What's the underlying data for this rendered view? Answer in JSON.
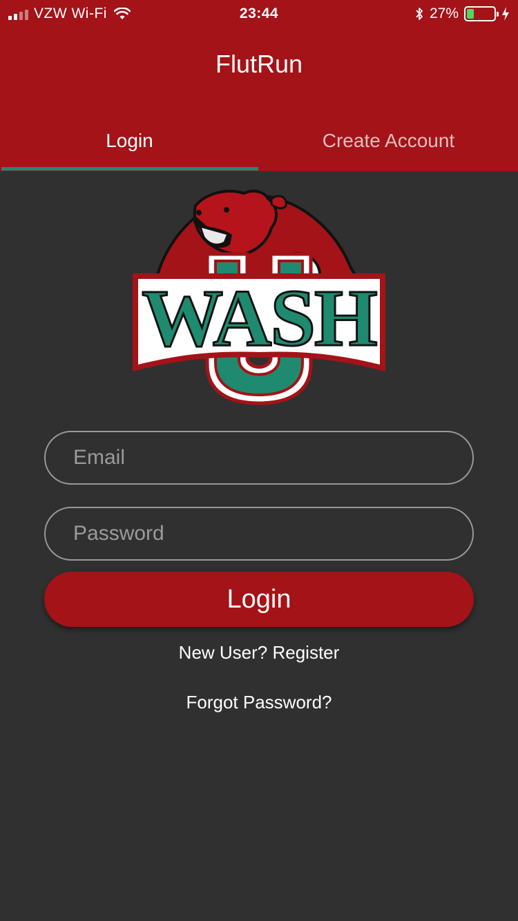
{
  "status_bar": {
    "carrier": "VZW Wi-Fi",
    "time": "23:44",
    "battery_percent": "27%",
    "battery_level": 0.27,
    "signal_bars": 2,
    "icons": [
      "signal-icon",
      "wifi-icon",
      "bluetooth-icon",
      "battery-icon",
      "charging-bolt-icon"
    ]
  },
  "app": {
    "title": "FlutRun",
    "brand_color": "#A31318",
    "accent_color": "#1F8A70",
    "background_color": "#303030"
  },
  "tabs": [
    {
      "label": "Login",
      "active": true
    },
    {
      "label": "Create Account",
      "active": false
    }
  ],
  "logo": {
    "text": "WASH",
    "letter": "U",
    "description_icon": "bear-mascot-logo"
  },
  "form": {
    "email_placeholder": "Email",
    "password_placeholder": "Password",
    "login_label": "Login"
  },
  "links": {
    "register": "New User? Register",
    "forgot": "Forgot Password?"
  }
}
